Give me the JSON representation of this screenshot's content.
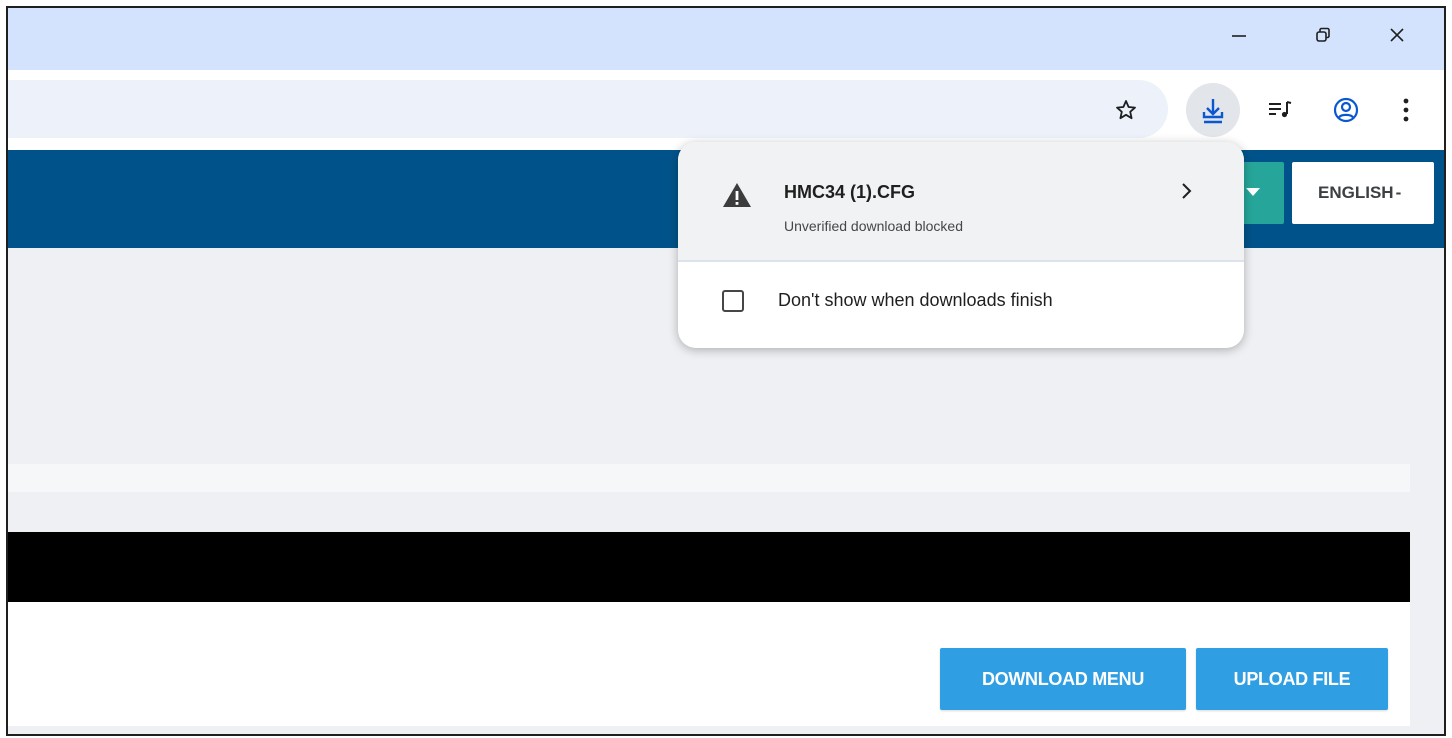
{
  "window_controls": {
    "minimize": "minimize-icon",
    "restore": "restore-icon",
    "close": "close-icon"
  },
  "toolbar": {
    "icons": [
      "star-icon",
      "download-icon",
      "media-queue-icon",
      "profile-icon",
      "more-vert-icon"
    ]
  },
  "site_header": {
    "language": "ENGLISH"
  },
  "download_popup": {
    "file_name": "HMC34 (1).CFG",
    "status": "Unverified download blocked",
    "checkbox_label": "Don't show when downloads finish",
    "checkbox_checked": false
  },
  "actions": {
    "download_menu": "DOWNLOAD MENU",
    "upload_file": "UPLOAD FILE"
  },
  "colors": {
    "titlebar": "#d3e3fd",
    "header": "#00538a",
    "teal": "#26a69a",
    "button_blue": "#2f9ee3",
    "download_icon_blue": "#0b57d0"
  }
}
